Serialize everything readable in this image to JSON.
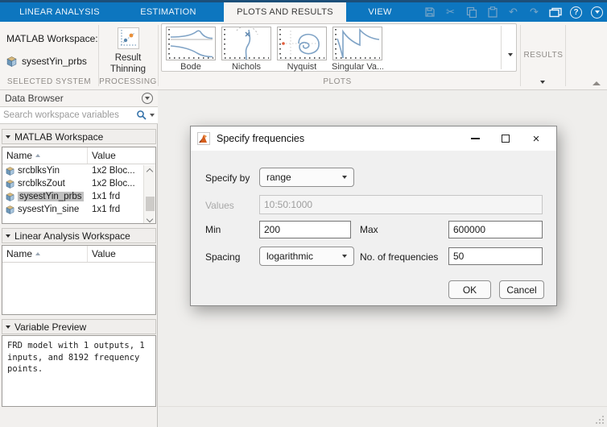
{
  "colors": {
    "tabbar_blue": "#0d76bf",
    "window_edge_navy": "#1c4f79",
    "ribbon_bg": "#f6f4f2",
    "section_label_gray": "#8f8b87",
    "selection_gray": "#c0c0c0",
    "plot_curve_blue": "#7fa3c6",
    "matlab_logo_orange": "#d55e1d",
    "dialog_bg": "#f0f0f0"
  },
  "tabbar": {
    "tabs": [
      {
        "label": "LINEAR ANALYSIS",
        "active": false
      },
      {
        "label": "ESTIMATION",
        "active": false
      },
      {
        "label": "PLOTS AND RESULTS",
        "active": true
      },
      {
        "label": "VIEW",
        "active": false
      }
    ],
    "quick_access": [
      "save-icon",
      "cut-icon",
      "copy-icon",
      "paste-icon",
      "undo-icon",
      "redo-icon",
      "dock-icon",
      "help-icon",
      "more-icon"
    ]
  },
  "icons": {
    "cut": "✂",
    "undo": "↶",
    "redo": "↷",
    "help": "?"
  },
  "ribbon": {
    "selected_system": {
      "workspace_label": "MATLAB Workspace:",
      "system_name": "sysestYin_prbs",
      "section_label": "SELECTED SYSTEM"
    },
    "processing": {
      "button_label": "Result Thinning",
      "section_label": "PROCESSING"
    },
    "plots": {
      "items": [
        {
          "label": "Bode"
        },
        {
          "label": "Nichols"
        },
        {
          "label": "Nyquist"
        },
        {
          "label": "Singular Va..."
        }
      ],
      "section_label": "PLOTS"
    },
    "results": {
      "section_label": "RESULTS"
    }
  },
  "data_browser": {
    "title": "Data Browser",
    "search_placeholder": "Search workspace variables",
    "matlab_workspace": {
      "header": "MATLAB Workspace",
      "columns": [
        "Name",
        "Value"
      ],
      "rows": [
        {
          "name": "srcblksYin",
          "value": "1x2 Bloc...",
          "selected": false
        },
        {
          "name": "srcblksZout",
          "value": "1x2 Bloc...",
          "selected": false
        },
        {
          "name": "sysestYin_prbs",
          "value": "1x1 frd",
          "selected": true
        },
        {
          "name": "sysestYin_sine",
          "value": "1x1 frd",
          "selected": false
        }
      ]
    },
    "linear_analysis_workspace": {
      "header": "Linear Analysis Workspace",
      "columns": [
        "Name",
        "Value"
      ],
      "rows": []
    },
    "variable_preview": {
      "header": "Variable Preview",
      "text": "FRD model with 1 outputs, 1\ninputs, and 8192 frequency\npoints."
    }
  },
  "dialog": {
    "title": "Specify frequencies",
    "fields": {
      "specify_by": {
        "label": "Specify by",
        "value": "range"
      },
      "values": {
        "label": "Values",
        "value": "10:50:1000",
        "disabled": true
      },
      "min": {
        "label": "Min",
        "value": "200"
      },
      "max": {
        "label": "Max",
        "value": "600000"
      },
      "spacing": {
        "label": "Spacing",
        "value": "logarithmic"
      },
      "num_frequencies": {
        "label": "No. of frequencies",
        "value": "50"
      }
    },
    "buttons": {
      "ok": "OK",
      "cancel": "Cancel"
    }
  }
}
